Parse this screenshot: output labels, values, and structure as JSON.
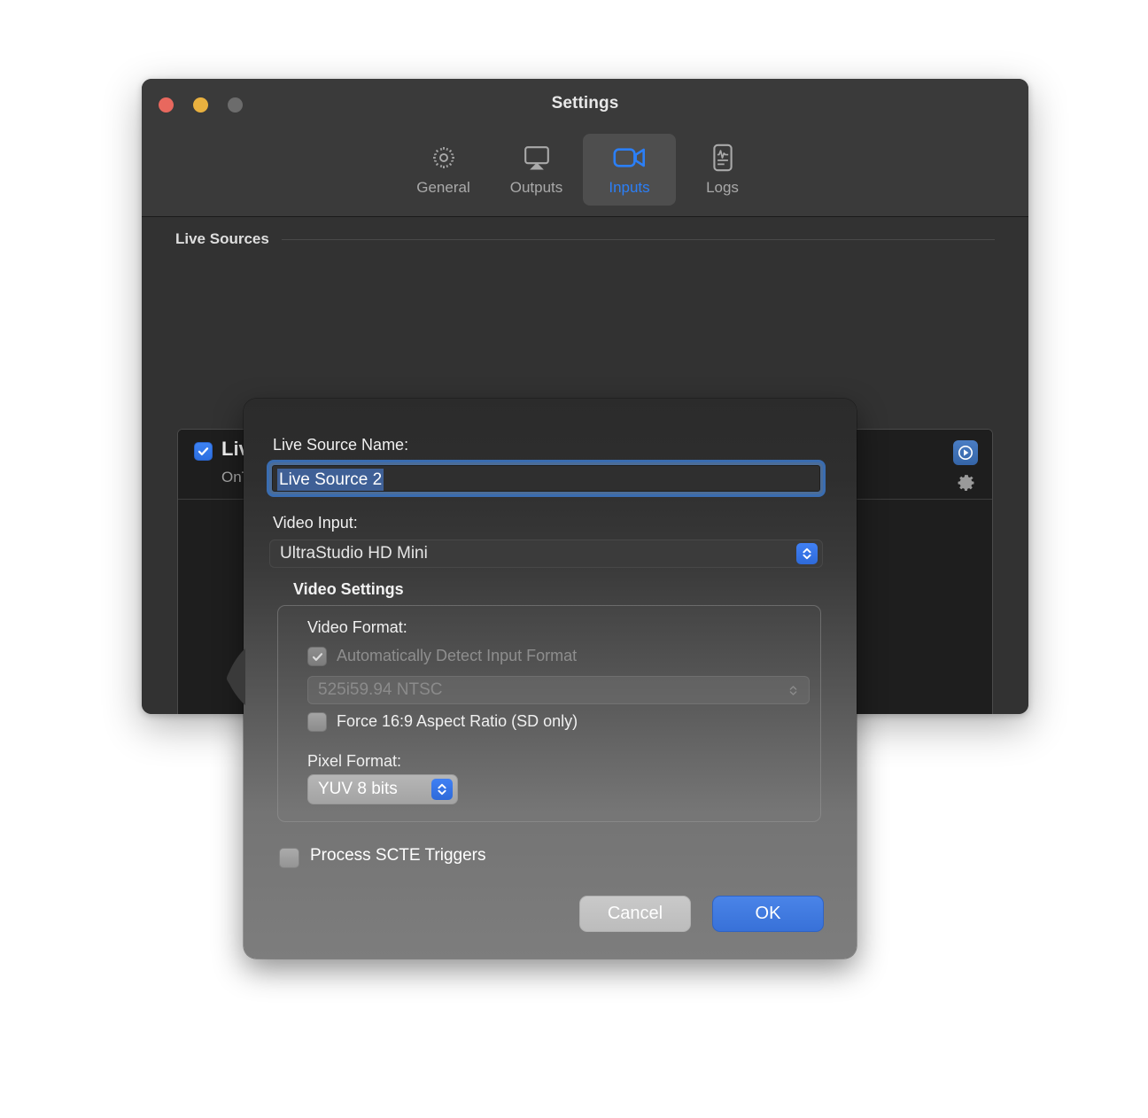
{
  "window": {
    "title": "Settings",
    "traffic_lights": [
      {
        "name": "close",
        "color": "#e8685e"
      },
      {
        "name": "minimize",
        "color": "#e9b13f"
      },
      {
        "name": "zoom",
        "color": "#6c6c6c"
      }
    ]
  },
  "toolbar": {
    "tabs": [
      {
        "label": "General",
        "icon": "gear-icon",
        "selected": false
      },
      {
        "label": "Outputs",
        "icon": "airplay-icon",
        "selected": false
      },
      {
        "label": "Inputs",
        "icon": "video-camera-icon",
        "selected": true
      },
      {
        "label": "Logs",
        "icon": "log-document-icon",
        "selected": false
      }
    ],
    "accent_color": "#2b7ff7"
  },
  "content": {
    "group_title": "Live Sources",
    "sources": [
      {
        "checked": true,
        "name": "Live Source",
        "subtitle": "OnTheAir Video <Missing>",
        "play_button_icon": "play-circle-icon",
        "gear_icon": "gear-icon"
      }
    ],
    "add_button_label": "+"
  },
  "dialog": {
    "name_label": "Live Source Name:",
    "name_value": "Live Source 2",
    "name_placeholder": "Live Source Name",
    "name_selected": true,
    "video_input_label": "Video Input:",
    "video_input_value": "UltraStudio HD Mini",
    "video_settings_title": "Video Settings",
    "video_format_label": "Video Format:",
    "auto_detect_label": "Automatically Detect Input Format",
    "auto_detect_checked": true,
    "auto_detect_disabled": true,
    "format_value": "525i59.94 NTSC",
    "format_disabled": true,
    "force_aspect_label": "Force 16:9 Aspect Ratio (SD only)",
    "force_aspect_checked": false,
    "pixel_format_label": "Pixel Format:",
    "pixel_format_value": "YUV 8 bits",
    "scte_label": "Process SCTE Triggers",
    "scte_checked": false,
    "cancel_label": "Cancel",
    "ok_label": "OK",
    "ok_color": "#3871d8"
  }
}
